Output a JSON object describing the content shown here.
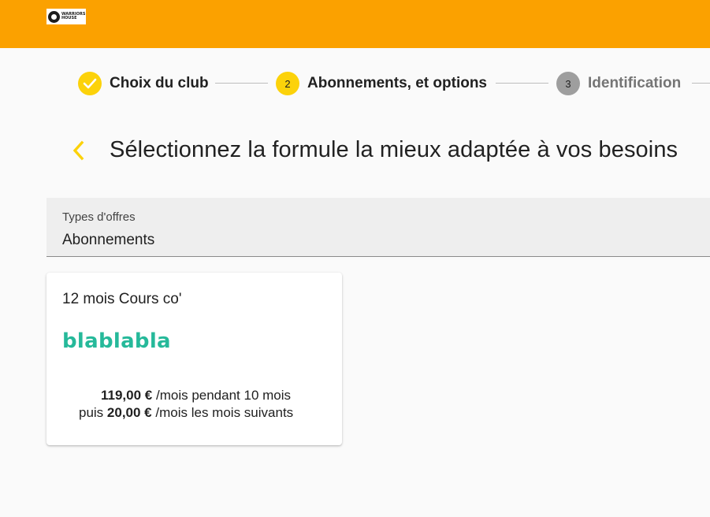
{
  "brand": {
    "logo_text": "WARRIORS\nHOUSE",
    "color_header": "#fba100"
  },
  "stepper": {
    "steps": [
      {
        "number": "",
        "label": "Choix du club",
        "state": "done",
        "icon": "check-icon"
      },
      {
        "number": "2",
        "label": "Abonnements, et options",
        "state": "active"
      },
      {
        "number": "3",
        "label": "Identification",
        "state": "inactive"
      }
    ],
    "colors": {
      "active": "#fcd20a",
      "inactive": "#9e9e9e"
    }
  },
  "page": {
    "title": "Sélectionnez la formule la mieux adaptée à vos besoins",
    "back_icon": "chevron-left-icon",
    "back_color": "#fcd20a"
  },
  "offer_type_select": {
    "label": "Types d'offres",
    "value": "Abonnements"
  },
  "offers": [
    {
      "title": "12 mois Cours co'",
      "brand": "blablabla",
      "brand_color": "#26b99a",
      "price_main": "119,00 €",
      "price_main_suffix": "/mois pendant 10 mois",
      "price_after_prefix": "puis",
      "price_after": "20,00 €",
      "price_after_suffix": "/mois les mois suivants"
    }
  ]
}
